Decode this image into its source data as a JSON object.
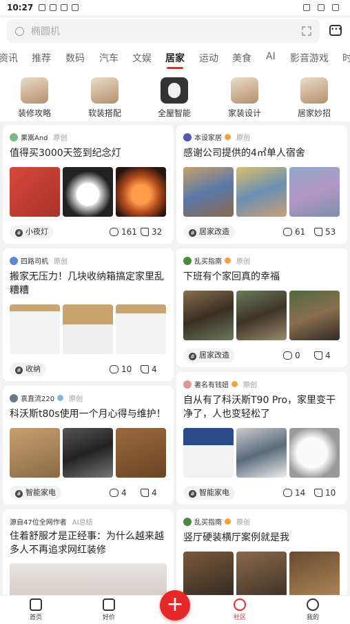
{
  "status": {
    "time": "10:27"
  },
  "search": {
    "placeholder": "椭圆机"
  },
  "tabs": [
    "资讯",
    "推荐",
    "数码",
    "汽车",
    "文娱",
    "居家",
    "运动",
    "美食",
    "AI",
    "影音游戏",
    "时"
  ],
  "active_tab": "居家",
  "categories": [
    "装修攻略",
    "软装搭配",
    "全屋智能",
    "家装设计",
    "居家妙招"
  ],
  "cards": [
    {
      "author": "果嵩And",
      "original": "原创",
      "title": "值得买3000天签到纪念灯",
      "tag": "小夜灯",
      "comments": "161",
      "likes": "32"
    },
    {
      "author": "本设家居",
      "original": "原创",
      "title": "感谢公司提供的4㎡单人宿舍",
      "tag": "居家改造",
      "comments": "61",
      "likes": "53"
    },
    {
      "author": "四路司机",
      "original": "原创",
      "title": "搬家无压力！几块收纳箱搞定家里乱糟糟",
      "tag": "收纳",
      "comments": "10",
      "likes": "4"
    },
    {
      "author": "乱买指南",
      "original": "原创",
      "title": "下班有个家回真的幸福",
      "tag": "居家改造",
      "comments": "0",
      "likes": "4"
    },
    {
      "author": "著名有钱妞",
      "original": "原创",
      "title": "自从有了科沃斯T90 Pro，家里变干净了，人也变轻松了",
      "tag": "智能家电",
      "comments": "14",
      "likes": "10"
    },
    {
      "author": "袁直流220",
      "original": "原创",
      "title": "科沃斯t80s使用一个月心得与维护！",
      "tag": "智能家电",
      "comments": "4",
      "likes": "4"
    },
    {
      "author": "源自47位全网作者",
      "original": "AI总结",
      "title": "住着舒服才是正经事：为什么越来越多人不再追求网红装修"
    },
    {
      "author": "乱买指南",
      "original": "原创",
      "title": "竖厅硬装横厅案例就是我"
    }
  ],
  "bottom_nav": [
    "首页",
    "好价",
    "社区",
    "我的"
  ],
  "colors": {
    "accent": "#e62828"
  }
}
